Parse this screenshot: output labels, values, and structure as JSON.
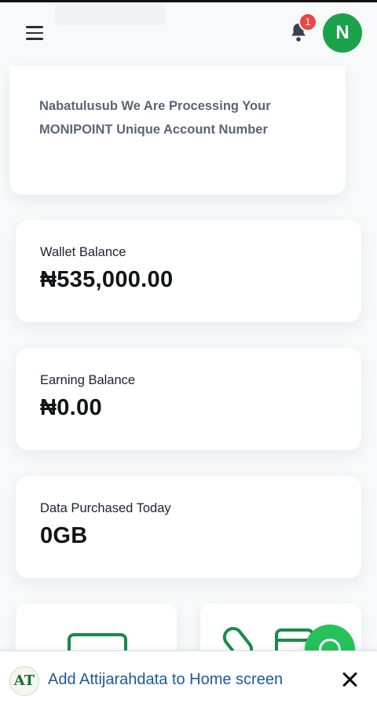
{
  "header": {
    "notification_count": "1",
    "avatar_initial": "N"
  },
  "notice": {
    "text": "Nabatulusub We Are Processing Your MONIPOINT Unique Account Number"
  },
  "balances": [
    {
      "label": "Wallet Balance",
      "value": "₦535,000.00"
    },
    {
      "label": "Earning Balance",
      "value": "₦0.00"
    },
    {
      "label": "Data Purchased Today",
      "value": "0GB"
    }
  ],
  "install_banner": {
    "logo_text": "AT",
    "text": "Add Attijarahdata to Home screen"
  },
  "icons": {
    "menu": "hamburger-menu-icon",
    "bell": "bell-icon",
    "whatsapp": "whatsapp-icon",
    "close": "close-icon"
  },
  "colors": {
    "brand_green": "#1aa34a",
    "badge_red": "#ef4444",
    "link_blue": "#1d5a9c"
  }
}
